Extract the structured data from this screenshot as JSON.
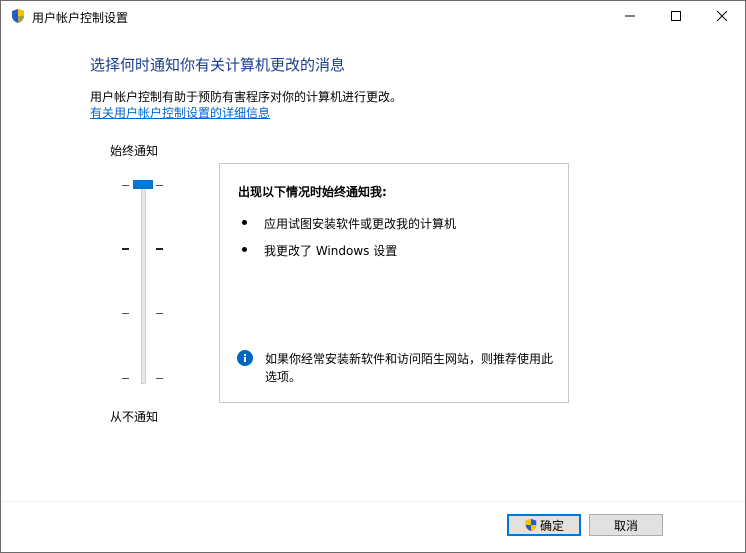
{
  "window": {
    "title": "用户帐户控制设置",
    "accent": "#0078d7"
  },
  "header": {
    "heading": "选择何时通知你有关计算机更改的消息",
    "description": "用户帐户控制有助于预防有害程序对你的计算机进行更改。",
    "link": "有关用户帐户控制设置的详细信息"
  },
  "slider": {
    "top_label": "始终通知",
    "bottom_label": "从不通知",
    "level": 4,
    "levels_total": 4
  },
  "info": {
    "title": "出现以下情况时始终通知我:",
    "bullets": [
      "应用试图安装软件或更改我的计算机",
      "我更改了 Windows 设置"
    ],
    "note": "如果你经常安装新软件和访问陌生网站，则推荐使用此选项。"
  },
  "buttons": {
    "ok": "确定",
    "cancel": "取消"
  }
}
